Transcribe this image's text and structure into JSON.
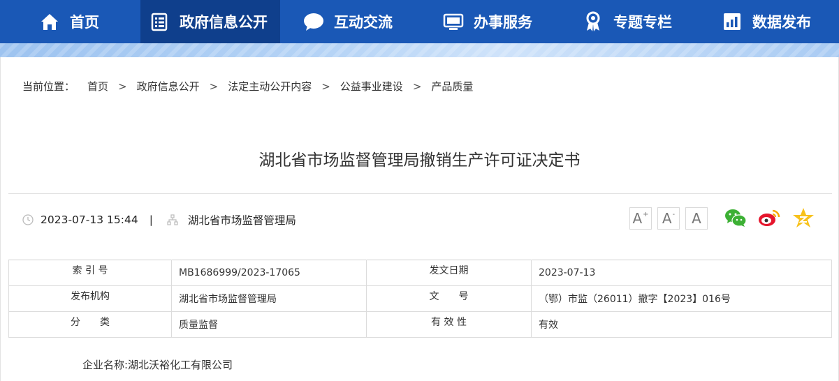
{
  "nav": {
    "items": [
      {
        "label": "首页",
        "icon": "home-icon"
      },
      {
        "label": "政府信息公开",
        "icon": "document-list-icon",
        "active": true
      },
      {
        "label": "互动交流",
        "icon": "chat-bubble-icon"
      },
      {
        "label": "办事服务",
        "icon": "monitor-icon"
      },
      {
        "label": "专题专栏",
        "icon": "award-badge-icon"
      },
      {
        "label": "数据发布",
        "icon": "bar-chart-icon"
      }
    ],
    "bg_color": "#1a58b6",
    "active_color": "#0f3f8c"
  },
  "breadcrumb": {
    "lead": "当前位置：",
    "items": [
      "首页",
      "政府信息公开",
      "法定主动公开内容",
      "公益事业建设",
      "产品质量"
    ],
    "separator": ">"
  },
  "article": {
    "title": "湖北省市场监督管理局撤销生产许可证决定书",
    "datetime": "2023-07-13 15:44",
    "meta_separator": "|",
    "publisher": "湖北省市场监督管理局"
  },
  "font_controls": {
    "larger": "A",
    "larger_mark": "+",
    "smaller": "A",
    "smaller_mark": "-",
    "normal": "A"
  },
  "share": {
    "icons": [
      "wechat-icon",
      "weibo-icon",
      "qzone-icon"
    ]
  },
  "info_table": {
    "rows": [
      {
        "k1": "索 引 号",
        "v1": "MB1686999/2023-17065",
        "k2": "发文日期",
        "v2": "2023-07-13"
      },
      {
        "k1": "发布机构",
        "v1": "湖北省市场监督管理局",
        "k2": "文　　号",
        "v2": "（鄂）市监（26011）撤字【2023】016号"
      },
      {
        "k1": "分　　类",
        "v1": "质量监督",
        "k2": "有 效 性",
        "v2": "有效"
      }
    ]
  },
  "content": {
    "line1": "企业名称:湖北沃裕化工有限公司"
  }
}
